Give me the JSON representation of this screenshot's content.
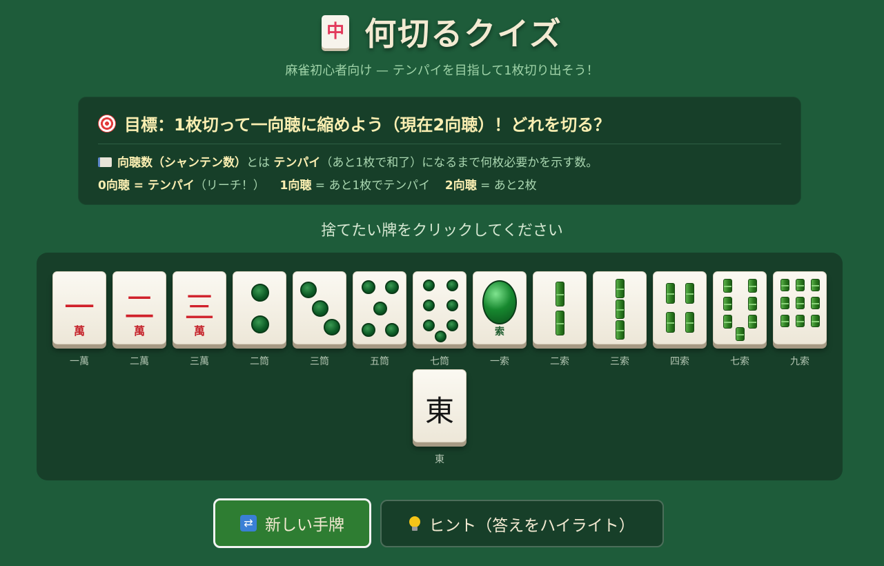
{
  "header": {
    "icon_char": "中",
    "title": "何切るクイズ",
    "subtitle": "麻雀初心者向け — テンパイを目指して1枚切り出そう！"
  },
  "goal": {
    "title": "目標：1枚切って一向聴に縮めよう（現在2向聴）！どれを切る？",
    "line1": {
      "b1": "向聴数（シャンテン数）",
      "t1": "とは",
      "b2": "テンパイ",
      "t2": "（あと1枚で和了）になるまで何枚必要かを示す数。"
    },
    "line2": {
      "b1": "0向聴 = テンパイ",
      "t1": "（リーチ！）",
      "b2": "1向聴",
      "t2": "= あと1枚でテンパイ",
      "b3": "2向聴",
      "t3": "= あと2枚"
    }
  },
  "instruction": "捨てたい牌をクリックしてください",
  "tiles": [
    {
      "label": "一萬",
      "suit": "man",
      "numeral": "一",
      "suit_char": "萬"
    },
    {
      "label": "二萬",
      "suit": "man",
      "numeral": "二",
      "suit_char": "萬"
    },
    {
      "label": "三萬",
      "suit": "man",
      "numeral": "三",
      "suit_char": "萬"
    },
    {
      "label": "二筒",
      "suit": "pin",
      "rank": 2
    },
    {
      "label": "三筒",
      "suit": "pin",
      "rank": 3
    },
    {
      "label": "五筒",
      "suit": "pin",
      "rank": 5
    },
    {
      "label": "七筒",
      "suit": "pin",
      "rank": 7
    },
    {
      "label": "一索",
      "suit": "sou1",
      "suit_char": "索"
    },
    {
      "label": "二索",
      "suit": "sou",
      "rank": 2
    },
    {
      "label": "三索",
      "suit": "sou",
      "rank": 3
    },
    {
      "label": "四索",
      "suit": "sou",
      "rank": 4
    },
    {
      "label": "七索",
      "suit": "sou",
      "rank": 7
    },
    {
      "label": "九索",
      "suit": "sou",
      "rank": 9
    },
    {
      "label": "東",
      "suit": "honor",
      "glyph": "東"
    }
  ],
  "buttons": {
    "new_hand": "新しい手牌",
    "hint": "ヒント（答えをハイライト）"
  },
  "colors": {
    "background": "#1e5c3a",
    "panel": "#173f29",
    "accent_text": "#fbefb2",
    "man_red": "#d0202a",
    "new_button": "#2e7d32"
  }
}
